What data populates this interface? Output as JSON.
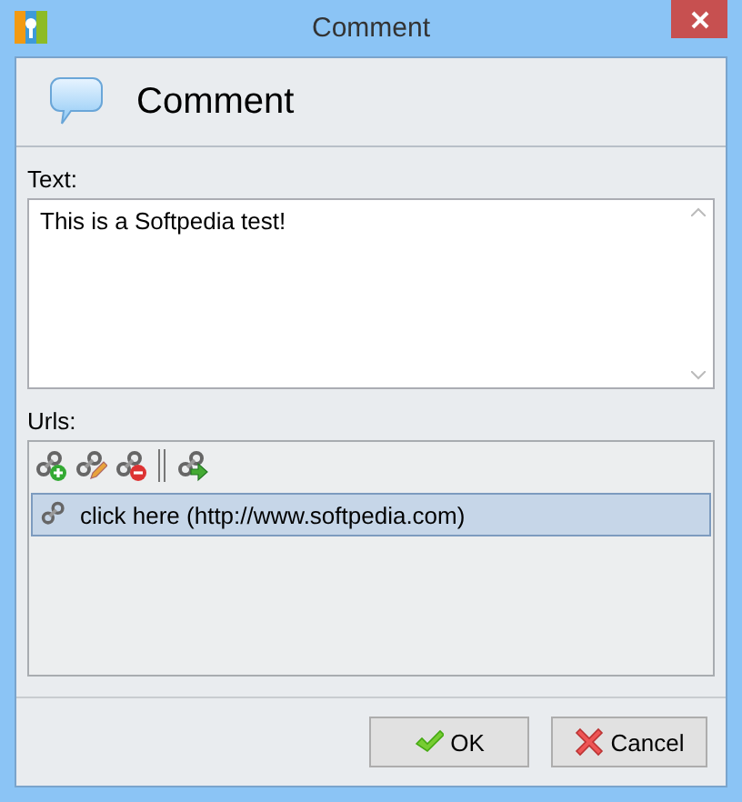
{
  "window": {
    "title": "Comment"
  },
  "header": {
    "title": "Comment"
  },
  "text_field": {
    "label": "Text:",
    "value": "This is a Softpedia test!"
  },
  "urls": {
    "label": "Urls:",
    "toolbar": [
      {
        "kind": "add"
      },
      {
        "kind": "edit"
      },
      {
        "kind": "remove"
      },
      {
        "kind": "separator"
      },
      {
        "kind": "open"
      }
    ],
    "items": [
      {
        "label": "click here (http://www.softpedia.com)",
        "selected": true
      }
    ]
  },
  "buttons": [
    {
      "kind": "ok",
      "label": "OK"
    },
    {
      "kind": "cancel",
      "label": "Cancel"
    }
  ]
}
